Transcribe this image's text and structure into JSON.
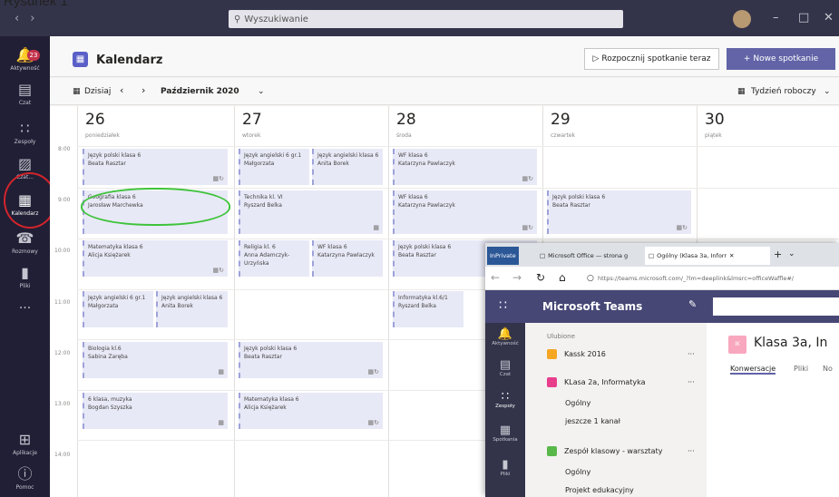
{
  "caption": "Rysunek 1",
  "search": {
    "placeholder": "Wyszukiwanie"
  },
  "rail": [
    {
      "label": "Aktywność",
      "badge": "23"
    },
    {
      "label": "Czat"
    },
    {
      "label": "Zespoły"
    },
    {
      "label": "Czat..."
    },
    {
      "label": "Kalendarz"
    },
    {
      "label": "Rozmowy"
    },
    {
      "label": "Pliki"
    },
    {
      "label": "..."
    },
    {
      "label": "Aplikacje"
    },
    {
      "label": "Pomoc"
    }
  ],
  "header": {
    "title": "Kalendarz",
    "meet_now": "Rozpocznij spotkanie teraz",
    "new_meeting": "Nowe spotkanie"
  },
  "toolbar": {
    "today": "Dzisiaj",
    "month": "Październik 2020",
    "view": "Tydzień roboczy"
  },
  "days": [
    {
      "num": "26",
      "name": "poniedziałek"
    },
    {
      "num": "27",
      "name": "wtorek"
    },
    {
      "num": "28",
      "name": "środa"
    },
    {
      "num": "29",
      "name": "czwartek"
    },
    {
      "num": "30",
      "name": "piątek"
    }
  ],
  "hours": [
    "8:00",
    "9:00",
    "10:00",
    "11:00",
    "12:00",
    "13:00",
    "14:00"
  ],
  "events": [
    {
      "title": "Język polski klasa 6",
      "person": "Beata Rasztar"
    },
    {
      "title": "Geografia klasa 6",
      "person": "Jarosław Marchewka"
    },
    {
      "title": "Matematyka klasa 6",
      "person": "Alicja Księżarek"
    },
    {
      "title": "Język angielski 6 gr.1",
      "person": "Małgorzata"
    },
    {
      "title": "Język angielski klasa 6",
      "person": "Anita Borek"
    },
    {
      "title": "Biologia kl.6",
      "person": "Sabina Zaręba"
    },
    {
      "title": "6 klasa, muzyka",
      "person": "Bogdan Szyszka"
    },
    {
      "title": "Język angielski 6 gr.1",
      "person": "Małgorzata"
    },
    {
      "title": "Język angielski klasa 6",
      "person": "Anita Borek"
    },
    {
      "title": "Technika kl. VI",
      "person": "Ryszard Belka"
    },
    {
      "title": "Religia kl. 6",
      "person": "Anna Adamczyk-Urzyńska"
    },
    {
      "title": "WF klasa 6",
      "person": "Katarzyna Pawlaczyk"
    },
    {
      "title": "Język polski klasa 6",
      "person": "Beata Rasztar"
    },
    {
      "title": "Matematyka klasa 6",
      "person": "Alicja Księżarek"
    },
    {
      "title": "WF klasa 6",
      "person": "Katarzyna Pawlaczyk"
    },
    {
      "title": "WF klasa 6",
      "person": "Katarzyna Pawlaczyk"
    },
    {
      "title": "Język polski klasa 6",
      "person": "Beata Rasztar"
    },
    {
      "title": "Informatyka kl.6/1",
      "person": "Ryszard Belka"
    },
    {
      "title": "Język polski klasa 6",
      "person": "Beata Rasztar"
    }
  ],
  "browser": {
    "tabs": [
      "InPrivate",
      "Microsoft Office — strona g",
      "Ogólny (Klasa 3a, Inforr"
    ],
    "url": "https://teams.microsoft.com/_?lm=deeplink&lmsrc=officeWaffle#/"
  },
  "teams": {
    "title": "Microsoft Teams",
    "favorites": "Ulubione",
    "rail": [
      "Aktywność",
      "Czat",
      "Zespoły",
      "Spotkania",
      "Pliki"
    ],
    "teams": [
      {
        "name": "Kassk 2016",
        "color": "#f5a623"
      },
      {
        "name": "KLasa 2a, Informatyka",
        "color": "#e83e8c"
      },
      {
        "name": "Zespół klasowy - warsztaty",
        "color": "#59b84a"
      }
    ],
    "channels": [
      "Ogólny",
      "jeszcze 1 kanał",
      "Ogólny",
      "Projekt edukacyjny"
    ],
    "team_title": "Klasa 3a, In",
    "team_badge": "IK",
    "tabs": [
      "Konwersacje",
      "Pliki",
      "No"
    ]
  },
  "colors": {
    "accent": "#6264a7",
    "rail": "#201f35",
    "annotation_red": "#d3242b",
    "annotation_green": "#3ec33a"
  }
}
